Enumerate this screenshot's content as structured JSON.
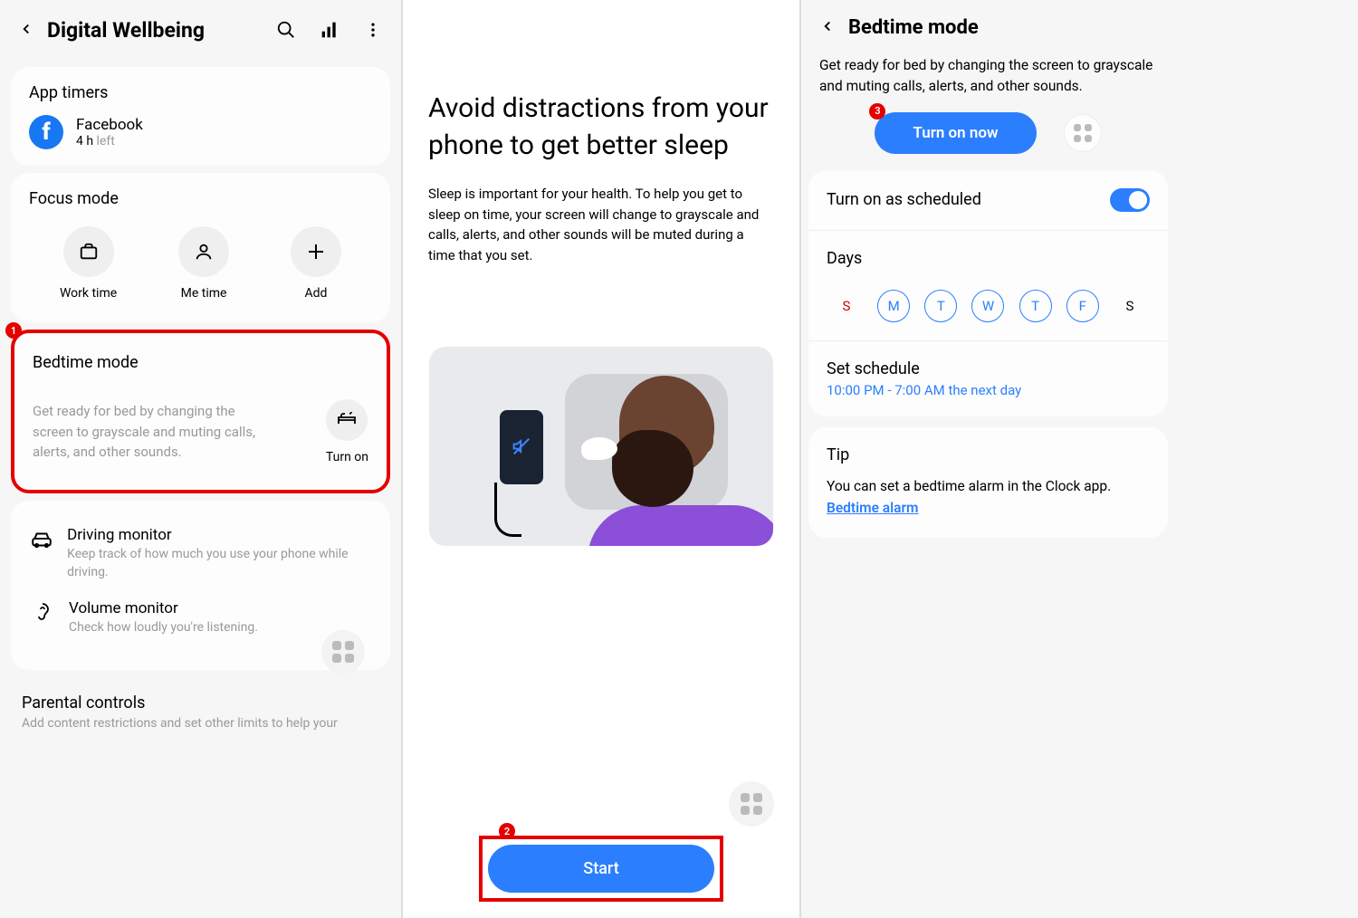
{
  "panel1": {
    "header_title": "Digital Wellbeing",
    "app_timers": {
      "title": "App timers",
      "app_name": "Facebook",
      "time": "4 h",
      "left": " left"
    },
    "focus_mode": {
      "title": "Focus mode",
      "items": [
        "Work time",
        "Me time",
        "Add"
      ]
    },
    "bedtime": {
      "title": "Bedtime mode",
      "desc": "Get ready for bed by changing the screen to grayscale and muting calls, alerts, and other sounds.",
      "turn_on": "Turn on"
    },
    "driving": {
      "title": "Driving monitor",
      "desc": "Keep track of how much you use your phone while driving."
    },
    "volume": {
      "title": "Volume monitor",
      "desc": "Check how loudly you're listening."
    },
    "parental": {
      "title": "Parental controls",
      "desc": "Add content restrictions and set other limits to help your"
    },
    "badge1": "1"
  },
  "panel2": {
    "heading": "Avoid distractions from your phone to get better sleep",
    "desc": "Sleep is important for your health. To help you get to sleep on time, your screen will change to grayscale and calls, alerts, and other sounds will be muted during a time that you set.",
    "start": "Start",
    "badge2": "2"
  },
  "panel3": {
    "title": "Bedtime mode",
    "desc": "Get ready for bed by changing the screen to grayscale and muting calls, alerts, and other sounds.",
    "turn_on_now": "Turn on now",
    "badge3": "3",
    "scheduled_label": "Turn on as scheduled",
    "days_label": "Days",
    "days": [
      "S",
      "M",
      "T",
      "W",
      "T",
      "F",
      "S"
    ],
    "set_schedule": "Set schedule",
    "schedule_time": "10:00 PM - 7:00 AM the next day",
    "tip_title": "Tip",
    "tip_text": "You can set a bedtime alarm in the Clock app.",
    "tip_link": "Bedtime alarm"
  }
}
